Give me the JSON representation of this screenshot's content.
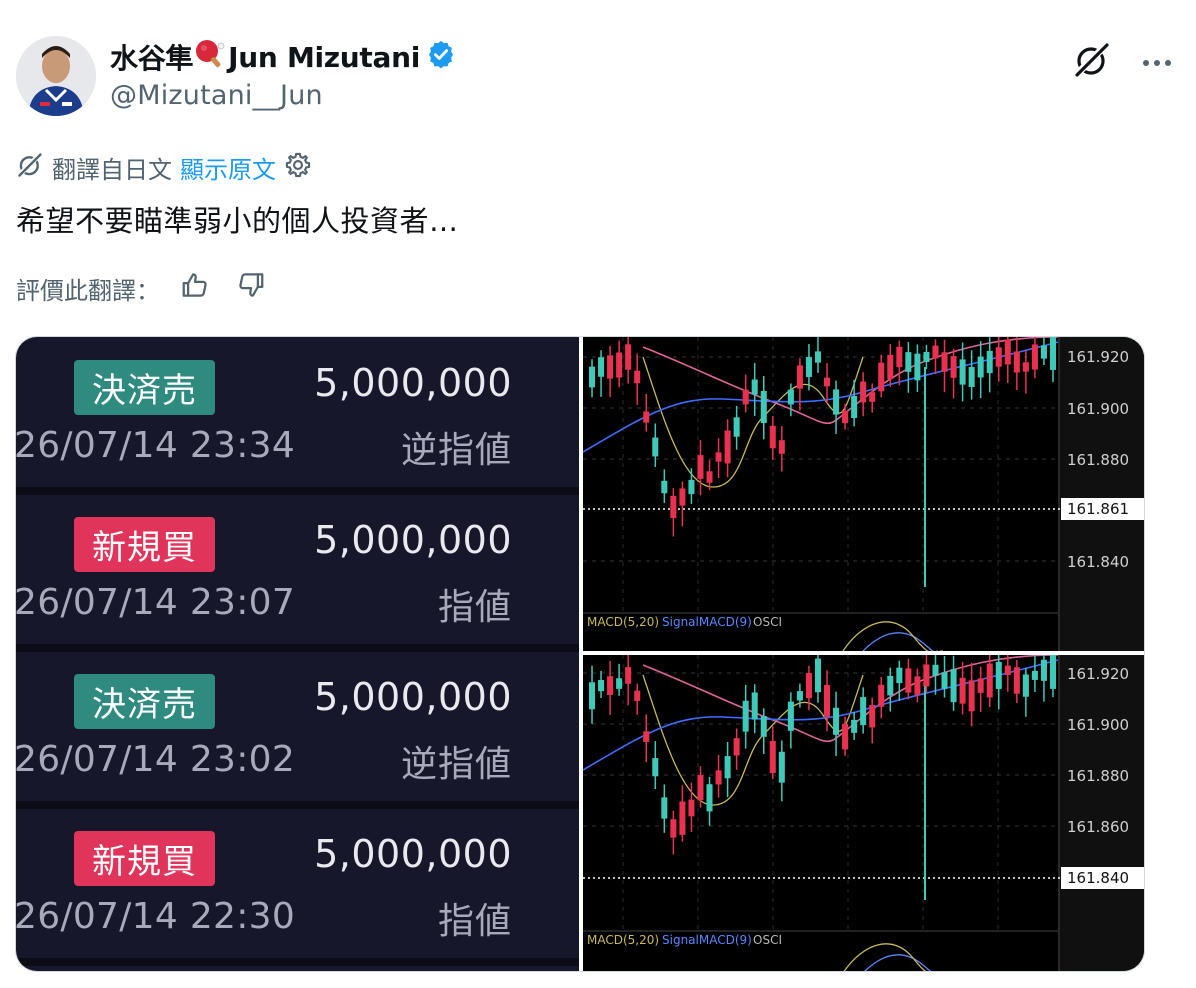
{
  "author": {
    "display_name": "水谷隼",
    "display_name_suffix": "Jun Mizutani",
    "handle": "@Mizutani__Jun"
  },
  "header_icons": [
    "grok-icon",
    "more-icon"
  ],
  "translation": {
    "label": "翻譯自日文",
    "show_original": "顯示原文"
  },
  "tweet": {
    "text": "希望不要瞄準弱小的個人投資者…"
  },
  "rating": {
    "label": "評價此翻譯：",
    "icons": [
      "thumbs-up-icon",
      "thumbs-down-icon"
    ]
  },
  "orders": [
    {
      "tag": "決済売",
      "tag_color": "#2f8a80",
      "date": "26/07/14 23:34",
      "qty": "5,000,000",
      "type": "逆指値"
    },
    {
      "tag": "新規買",
      "tag_color": "#e0345a",
      "date": "26/07/14 23:07",
      "qty": "5,000,000",
      "type": "指値"
    },
    {
      "tag": "決済売",
      "tag_color": "#2f8a80",
      "date": "26/07/14 23:02",
      "qty": "5,000,000",
      "type": "逆指値"
    },
    {
      "tag": "新規買",
      "tag_color": "#e0345a",
      "date": "26/07/14 22:30",
      "qty": "5,000,000",
      "type": "指値"
    }
  ],
  "charts": [
    {
      "price_labels": [
        "161.920",
        "161.900",
        "161.880",
        "161.840"
      ],
      "current_price": "161.861",
      "indicator_label_1": "MACD(5,20)",
      "indicator_label_2": "SignalMACD(9)",
      "indicator_label_3": "OSCI"
    },
    {
      "price_labels": [
        "161.920",
        "161.900",
        "161.880",
        "161.860"
      ],
      "current_price": "161.840",
      "indicator_label_1": "MACD(5,20)",
      "indicator_label_2": "SignalMACD(9)",
      "indicator_label_3": "OSCI"
    }
  ],
  "colors": {
    "text_primary": "#0f1419",
    "text_secondary": "#536471",
    "link": "#1d9bf0",
    "verified": "#1d9bf0",
    "bull_candle": "#3fc9b8",
    "bear_candle": "#e8324f"
  }
}
